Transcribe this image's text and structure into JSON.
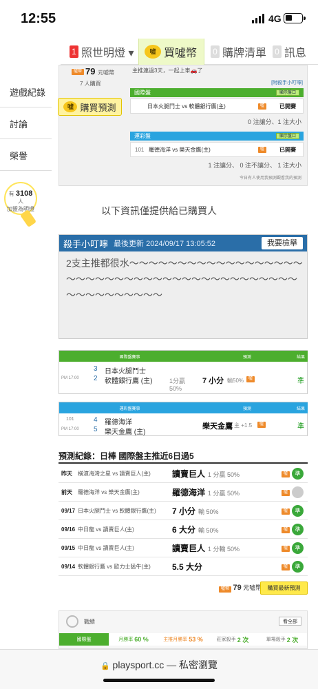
{
  "status": {
    "time": "12:55",
    "network": "4G"
  },
  "nav": {
    "user_count": "1",
    "user_label": "照世明燈 ▾",
    "coin_icon": "噓",
    "coin_label": "買噓幣",
    "cart_count": "0",
    "cart_label": "購牌清單",
    "msg_count": "0",
    "msg_label": "訊息"
  },
  "sidebar": {
    "items": [
      "遊戲紀錄",
      "討論",
      "榮譽"
    ],
    "bulb_prefix": "有",
    "bulb_count": "3108",
    "bulb_suffix": "人",
    "bulb_caption": "加盟為明燈"
  },
  "summary": {
    "price": "79",
    "price_unit": "元噓幣",
    "buyers": "7 人購買",
    "streak": "主推連過3天，一起上車🚗了",
    "buy_button": "購買預測",
    "killer_link": "[附殺手小叮嚀]",
    "intl": {
      "header": "國際盤",
      "show_btn": "顯示盤口",
      "game": "日本火腿鬥士 vs 軟體銀行鷹(主)",
      "status": "已開賽",
      "stat": "0 注讓分、1 注大小"
    },
    "lottery": {
      "header": "運彩盤",
      "show_btn": "顯示盤口",
      "num": "101",
      "game": "羅德海洋 vs 樂天金鷹(主)",
      "status": "已開賽",
      "stat": "1 注讓分、 0 注不讓分、 1 注大小"
    },
    "note": "今日有人使用我預測觀看我的預測"
  },
  "info_title": "以下資訊僅提供給已購買人",
  "killer": {
    "title": "殺手小叮嚀",
    "updated": "最後更新 2024/09/17 13:05:52",
    "report": "我要檢舉",
    "text": "2支主推都很水～～～～～～～～～～～～～～～～～～～～～～～～～～～～～～～～～～～～～～～～～～～～～～～～～～～～"
  },
  "intl_table": {
    "headers": [
      "國際盤賽事",
      "預測",
      "結果"
    ],
    "time": "PM 17:00",
    "home_no": "3",
    "home": "日本火腿鬥士",
    "away_no": "2",
    "away": "軟體銀行鷹 (主)",
    "line": "1分贏",
    "line_pct": "50%",
    "pick": "7 小分",
    "pick_sub": "輸50%",
    "result": "準"
  },
  "lottery_table": {
    "headers": [
      "運彩盤賽事",
      "預測",
      "結果"
    ],
    "num": "101",
    "time": "PM 17:00",
    "home_no": "4",
    "home": "羅德海洋",
    "away_no": "5",
    "away": "樂天金鷹 (主)",
    "pick": "樂天金鷹",
    "pick_sub": "主 +1.5",
    "result": "準"
  },
  "record": {
    "title": "預測紀錄：日棒 國際盤主推近6日過5",
    "rows": [
      {
        "date": "昨天",
        "game": "橫濱海灣之星 vs 讀賣巨人(主)",
        "pick": "讀賣巨人",
        "odds": "1 分贏 50%",
        "result": "準"
      },
      {
        "date": "前天",
        "game": "羅德海洋 vs 樂天金鷹(主)",
        "pick": "羅德海洋",
        "odds": "1 分贏 50%",
        "result": ""
      },
      {
        "date": "09/17",
        "game": "日本火腿鬥士 vs 軟體銀行鷹(主)",
        "pick": "7 小分",
        "odds": "輸 50%",
        "result": "準"
      },
      {
        "date": "09/16",
        "game": "中日龍 vs 讀賣巨人(主)",
        "pick": "6 大分",
        "odds": "輸 50%",
        "result": "準"
      },
      {
        "date": "09/15",
        "game": "中日龍 vs 讀賣巨人(主)",
        "pick": "讀賣巨人",
        "odds": "1 分輸 50%",
        "result": "準"
      },
      {
        "date": "09/14",
        "game": "軟體銀行鷹 vs 歐力士猛牛(主)",
        "pick": "5.5 大分",
        "odds": "",
        "result": "準"
      }
    ]
  },
  "purchase": {
    "price": "79",
    "unit": "元噓幣",
    "button": "購買最新預測"
  },
  "results": {
    "title": "戰績",
    "all_btn": "看全部",
    "cells": [
      {
        "label": "國際盤",
        "value": ""
      },
      {
        "label": "月勝率",
        "value": "60 %"
      },
      {
        "label": "主推月勝率",
        "value": "53 %"
      },
      {
        "label": "莊家殺手",
        "value": "2 次"
      },
      {
        "label": "單場殺手",
        "value": "2 次"
      }
    ]
  },
  "browser": {
    "url": "playsport.cc — 私密瀏覽"
  },
  "colors": {
    "green": "#4cae2e",
    "blue": "#2a6ea8",
    "orange": "#ee8a2a",
    "yellow": "#ffe94a"
  }
}
